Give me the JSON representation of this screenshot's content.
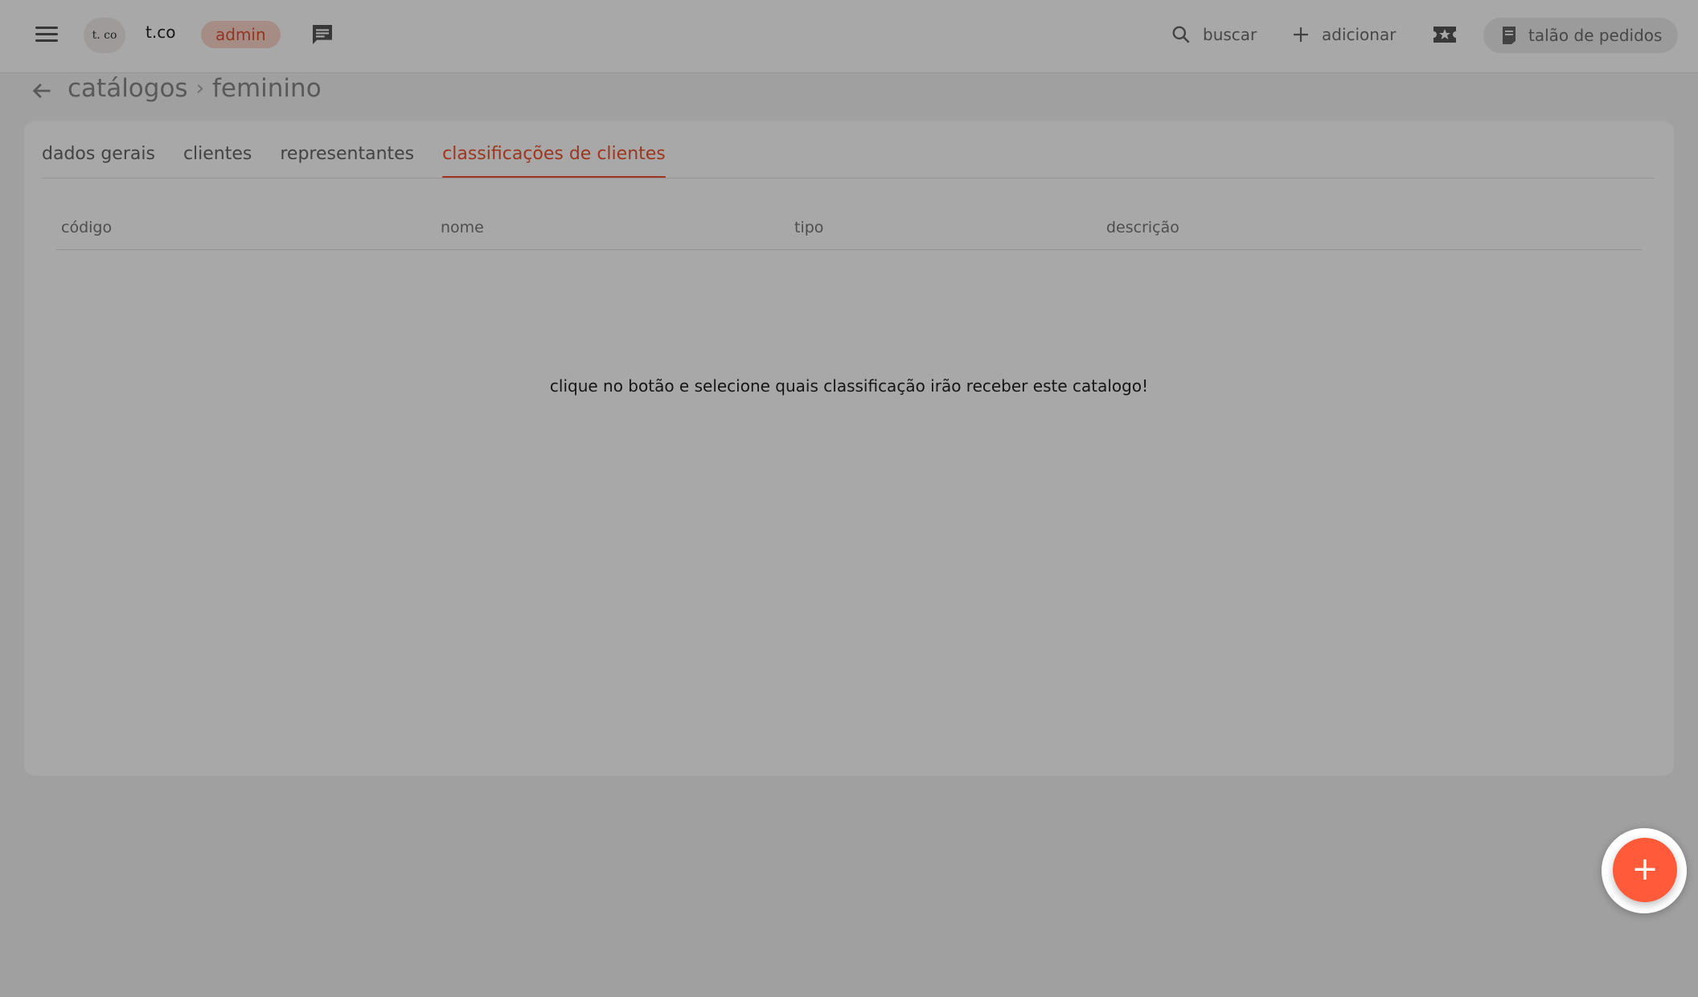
{
  "header": {
    "logo_text": "t. co",
    "brand": "t.co",
    "role_badge": "admin",
    "search_label": "buscar",
    "add_label": "adicionar",
    "orders_label": "talão de pedidos"
  },
  "breadcrumb": {
    "parent": "catálogos",
    "separator": "›",
    "current": "feminino"
  },
  "tabs": [
    {
      "label": "dados gerais",
      "active": false
    },
    {
      "label": "clientes",
      "active": false
    },
    {
      "label": "representantes",
      "active": false
    },
    {
      "label": "classificações de clientes",
      "active": true
    }
  ],
  "table": {
    "columns": [
      "código",
      "nome",
      "tipo",
      "descrição"
    ],
    "rows": [],
    "empty_message": "clique no botão e selecione quais classificação irão receber este catalogo!"
  },
  "fab": {
    "label": "+"
  },
  "colors": {
    "accent": "#f0532f",
    "fab": "#ff5a3a",
    "badge_bg": "#fbd6cc"
  }
}
